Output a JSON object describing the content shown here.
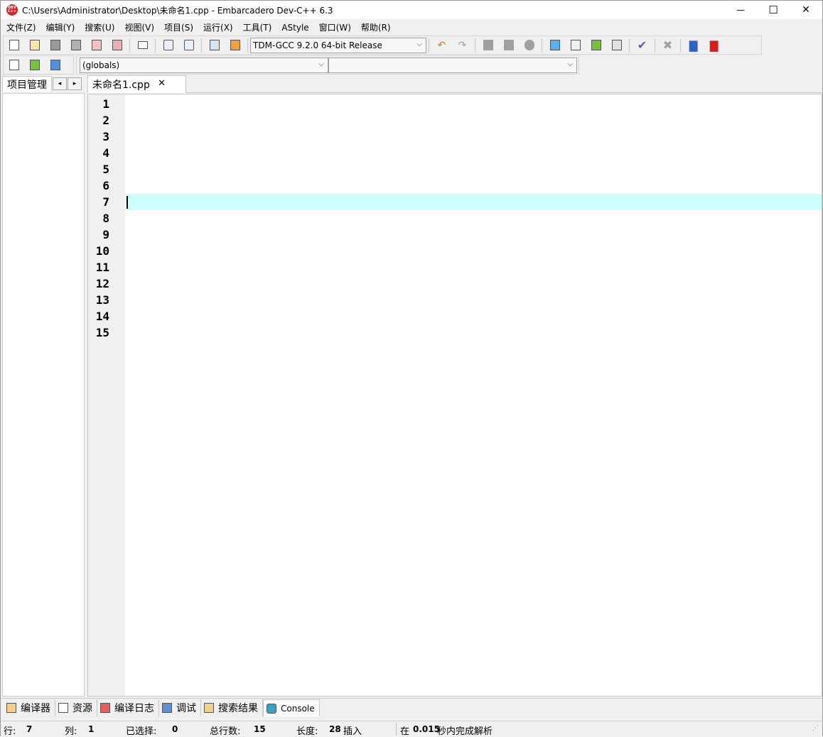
{
  "window": {
    "title": "C:\\Users\\Administrator\\Desktop\\未命名1.cpp - Embarcadero Dev-C++ 6.3",
    "app_icon_text": "DEV C++",
    "minimize": "—",
    "maximize": "☐",
    "close": "✕"
  },
  "menu": [
    "文件(Z)",
    "编辑(Y)",
    "搜索(U)",
    "视图(V)",
    "项目(S)",
    "运行(X)",
    "工具(T)",
    "AStyle",
    "窗口(W)",
    "帮助(R)"
  ],
  "toolbar": {
    "compiler_select": "TDM-GCC 9.2.0 64-bit Release",
    "globals_select": "(globals)",
    "member_select": ""
  },
  "project_panel": {
    "tab_label": "项目管理",
    "prev": "◂",
    "next": "▸"
  },
  "editor": {
    "tab_label": "未命名1.cpp",
    "tab_close": "✕",
    "line_numbers": [
      "1",
      "2",
      "3",
      "4",
      "5",
      "6",
      "7",
      "8",
      "9",
      "10",
      "11",
      "12",
      "13",
      "14",
      "15"
    ],
    "current_line": 7
  },
  "bottom_tabs": [
    "编译器",
    "资源",
    "编译日志",
    "调试",
    "搜索结果",
    "Console"
  ],
  "status": {
    "row_label": "行:",
    "row_value": "7",
    "col_label": "列:",
    "col_value": "1",
    "sel_label": "已选择:",
    "sel_value": "0",
    "total_label": "总行数:",
    "total_value": "15",
    "len_label": "长度:",
    "len_value": "28",
    "mode": "插入",
    "parse_prefix": "在",
    "parse_time": "0.015",
    "parse_suffix": "秒内完成解析"
  },
  "colors": {
    "current_line_bg": "#ccffff",
    "gutter_bg": "#f0f0f0",
    "app_icon": "#d0282b"
  }
}
